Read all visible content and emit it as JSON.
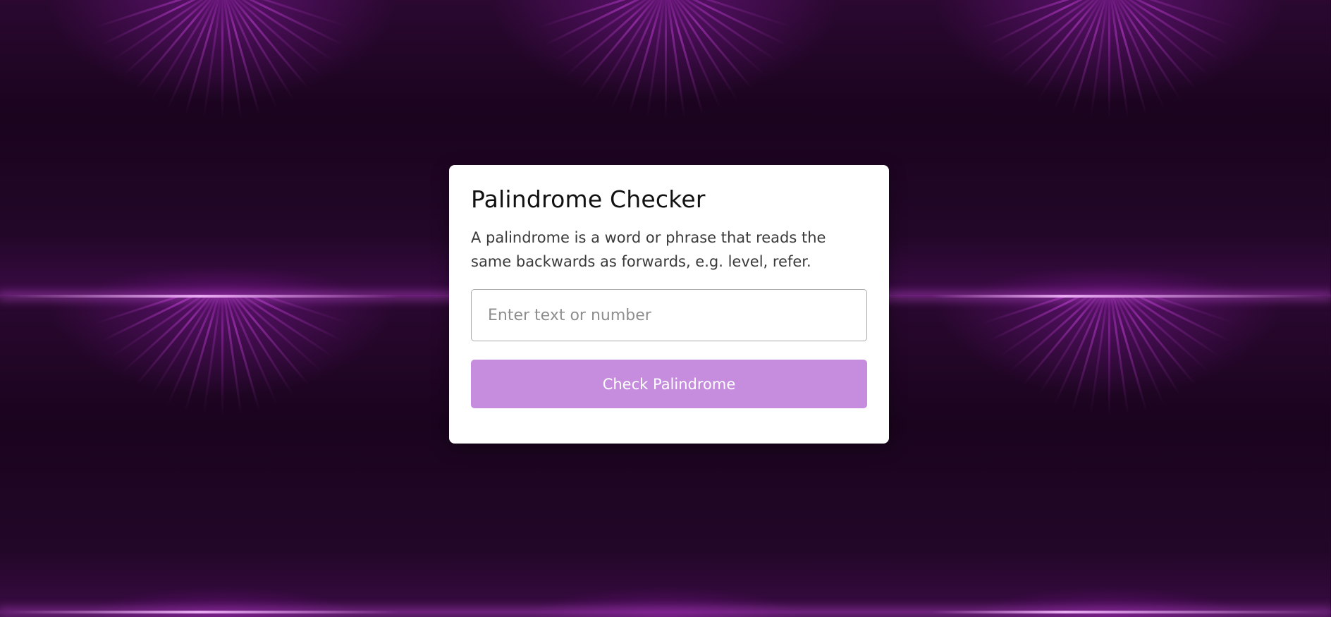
{
  "page": {
    "title": "Palindrome Checker",
    "description": "A palindrome is a word or phrase that reads the same backwards as forwards, e.g. level, refer."
  },
  "form": {
    "input_placeholder": "Enter text or number",
    "input_value": "",
    "button_label": "Check Palindrome"
  },
  "colors": {
    "background": "#1c0620",
    "card": "#ffffff",
    "button": "#c68cdd",
    "button_text": "#ffffff"
  }
}
